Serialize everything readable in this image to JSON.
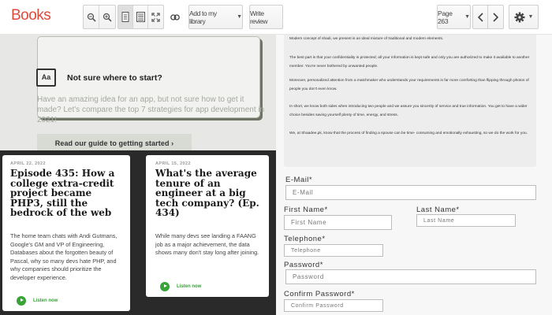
{
  "toolbar": {
    "brand": "Books",
    "add_to_library": "Add to my library",
    "write_review": "Write review",
    "page_label": "Page 263"
  },
  "blog": {
    "callout_icon": "Aa",
    "callout_title": "Not sure where to start?",
    "callout_body": "Have an amazing idea for an app, but not sure how to get it made? Let's compare the top 7 strategies for app development in 2021!",
    "guide_button": "Read our guide to getting started ›",
    "cards": [
      {
        "date": "APRIL 22, 2022",
        "title": "Episode 435: How a college extra-credit project became PHP3, still the bedrock of the web",
        "description": "The home team chats with Andi Gutmans, Google's GM and VP of Engineering, Databases about the forgotten beauty of Pascal, why so many devs hate PHP, and why companies should prioritize the developer experience.",
        "action": "Listen now"
      },
      {
        "date": "APRIL 15, 2022",
        "title": "What's the average tenure of an engineer at a big tech company? (Ep. 434)",
        "description": "While many devs see landing a FAANG job as a major achievement, the data shows many don't stay long after joining.",
        "action": "Listen now"
      }
    ]
  },
  "article": {
    "paragraphs": [
      "Modern concept of shadi, we present is an ideal mixture of traditional and modern elements.",
      "The best part is that your confidentiality is protected; all your information is kept safe and only you are authorized to make it available to another member. You're never bothered by unwanted people.",
      "Moreover, personalized attention from a matchmaker who understands your requirements is far more comforting than flipping through photos of people you don't even know.",
      "In short, we know both sides when introducing two people and we assure you sincerity of service and true information. You get to have a wider choice besides saving yourself plenty of time, energy, and stress.",
      "We, at Shaadee.pk, know that the process of finding a spouse can be time- consuming and emotionally exhausting, so we do the work for you."
    ]
  },
  "form": {
    "email_label": "E-Mail*",
    "email_placeholder": "E-Mail",
    "first_name_label": "First Name*",
    "first_name_placeholder": "First Name",
    "last_name_label": "Last Name*",
    "last_name_placeholder": "Last Name",
    "telephone_label": "Telephone*",
    "telephone_placeholder": "Telephone",
    "password_label": "Password*",
    "password_placeholder": "Password",
    "confirm_label": "Confirm Password*",
    "confirm_placeholder": "Confirm Password"
  },
  "colors": {
    "brand_red": "#dd4b39",
    "accent_green": "#38a336",
    "dark_bg": "#2a2a2a"
  }
}
